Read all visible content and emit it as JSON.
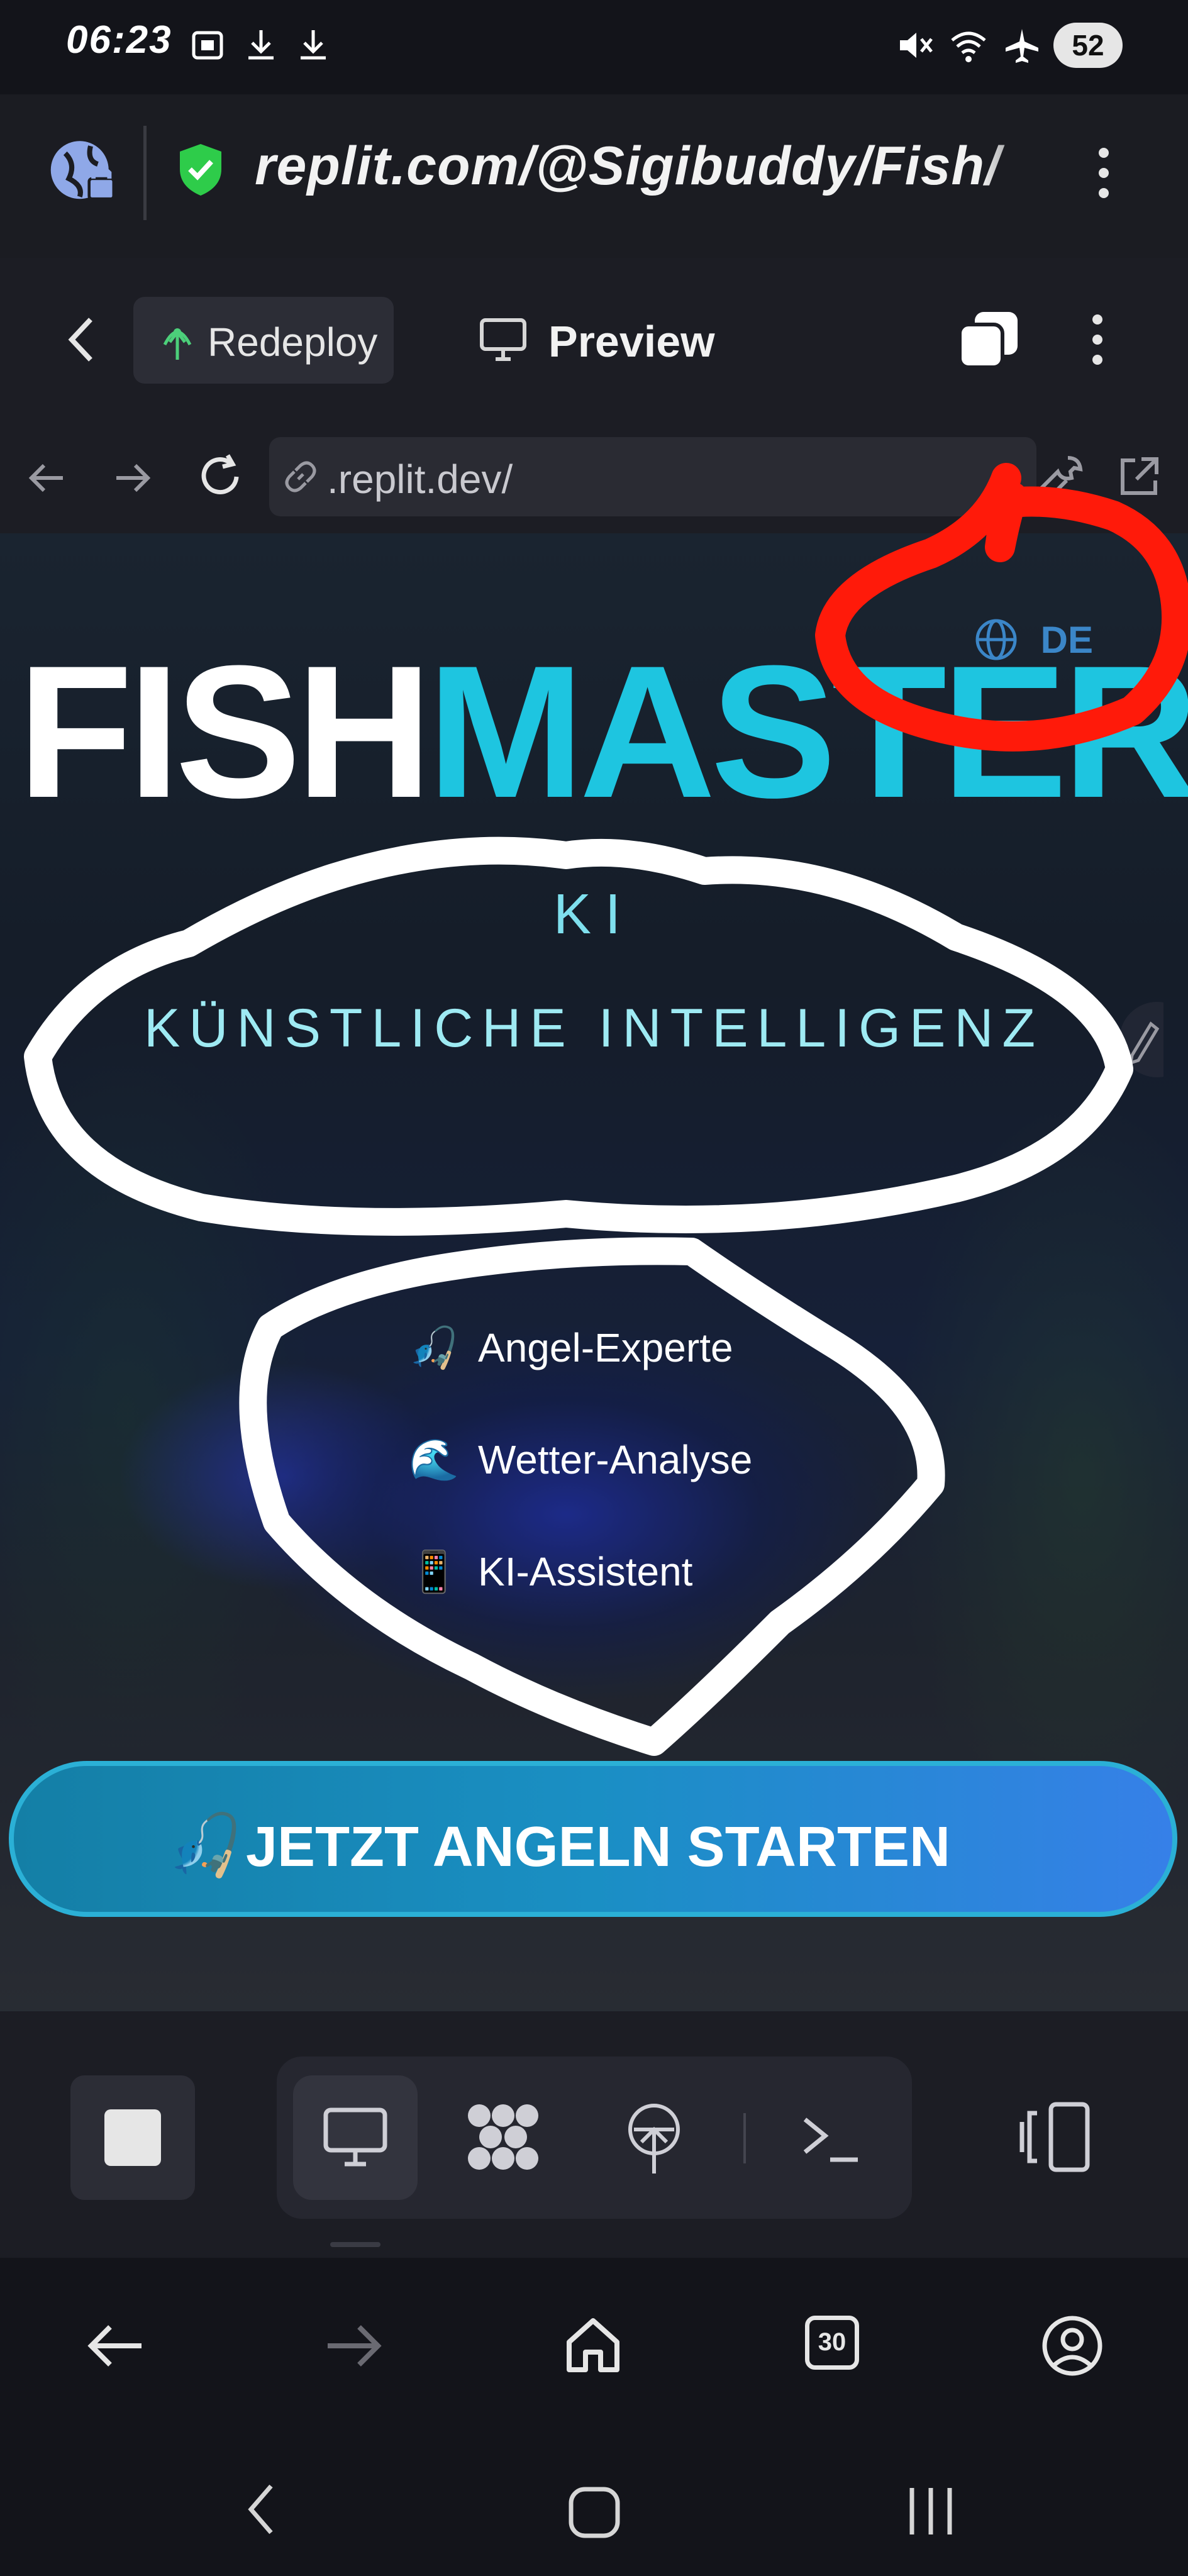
{
  "status_bar": {
    "time": "06:23",
    "battery": "52"
  },
  "browser": {
    "url": "replit.com/@Sigibuddy/Fish/"
  },
  "replit_toolbar": {
    "redeploy_label": "Redeploy",
    "preview_label": "Preview"
  },
  "webview": {
    "address": ".replit.dev/"
  },
  "app": {
    "title_part1": "FISH",
    "title_part2": "MASTER",
    "language": "DE",
    "ki": "KI",
    "ki_subtitle": "KÜNSTLICHE INTELLIGENZ",
    "features": [
      {
        "emoji": "🎣",
        "label": "Angel-Experte"
      },
      {
        "emoji": "🌊",
        "label": "Wetter-Analyse"
      },
      {
        "emoji": "📱",
        "label": "KI-Assistent"
      }
    ],
    "cta_emoji": "🎣",
    "cta_label": "JETZT ANGELN STARTEN"
  },
  "browser_bottom": {
    "tab_count": "30"
  },
  "colors": {
    "accent_cyan": "#1ec5e0",
    "cta_blue": "#1a8fc4",
    "annotation_red": "#ff1a0a",
    "annotation_white": "#ffffff"
  }
}
